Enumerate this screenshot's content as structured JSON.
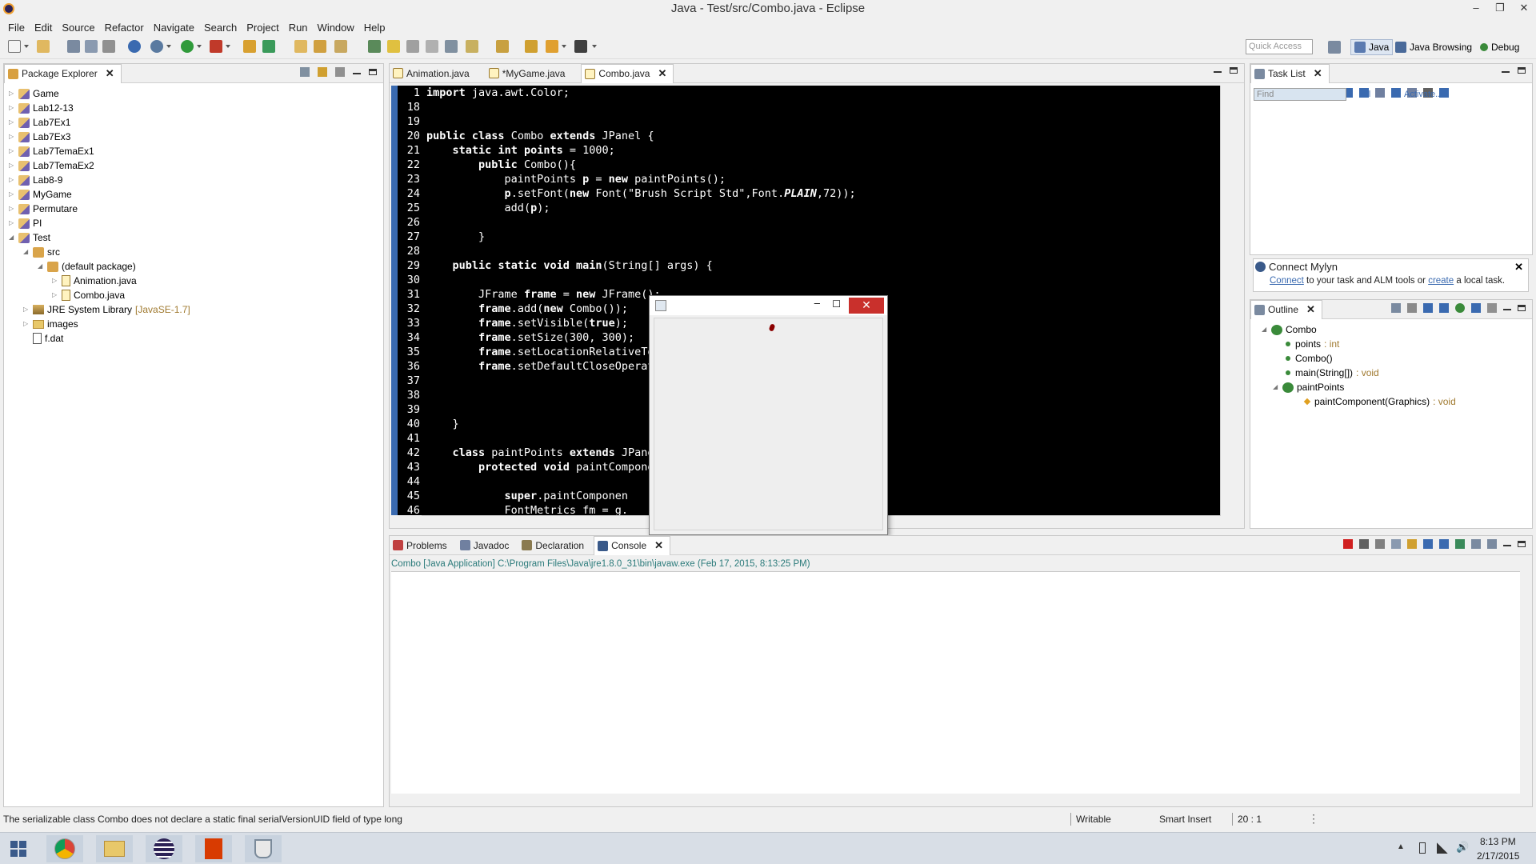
{
  "window": {
    "title": "Java - Test/src/Combo.java - Eclipse"
  },
  "menu": [
    "File",
    "Edit",
    "Source",
    "Refactor",
    "Navigate",
    "Search",
    "Project",
    "Run",
    "Window",
    "Help"
  ],
  "toolbar": {
    "quick_access_placeholder": "Quick Access"
  },
  "perspectives": [
    {
      "label": "Java",
      "active": true
    },
    {
      "label": "Java Browsing",
      "active": false
    },
    {
      "label": "Debug",
      "active": false
    }
  ],
  "package_explorer": {
    "title": "Package Explorer",
    "items": [
      {
        "label": "Game",
        "kind": "project",
        "depth": 0
      },
      {
        "label": "Lab12-13",
        "kind": "project",
        "depth": 0
      },
      {
        "label": "Lab7Ex1",
        "kind": "project",
        "depth": 0
      },
      {
        "label": "Lab7Ex3",
        "kind": "project",
        "depth": 0
      },
      {
        "label": "Lab7TemaEx1",
        "kind": "project",
        "depth": 0
      },
      {
        "label": "Lab7TemaEx2",
        "kind": "project",
        "depth": 0
      },
      {
        "label": "Lab8-9",
        "kind": "project",
        "depth": 0
      },
      {
        "label": "MyGame",
        "kind": "project",
        "depth": 0
      },
      {
        "label": "Permutare",
        "kind": "project",
        "depth": 0
      },
      {
        "label": "PI",
        "kind": "project",
        "depth": 0
      },
      {
        "label": "Test",
        "kind": "project",
        "depth": 0
      },
      {
        "label": "src",
        "kind": "source-folder",
        "depth": 1
      },
      {
        "label": "(default package)",
        "kind": "package",
        "depth": 2
      },
      {
        "label": "Animation.java",
        "kind": "java",
        "depth": 3
      },
      {
        "label": "Combo.java",
        "kind": "java",
        "depth": 3
      },
      {
        "label": "JRE System Library",
        "suffix": "[JavaSE-1.7]",
        "kind": "library",
        "depth": 1
      },
      {
        "label": "images",
        "kind": "folder",
        "depth": 1
      },
      {
        "label": "f.dat",
        "kind": "file",
        "depth": 1
      }
    ]
  },
  "editor": {
    "tabs": [
      {
        "label": "Animation.java",
        "active": false
      },
      {
        "label": "*MyGame.java",
        "active": false
      },
      {
        "label": "Combo.java",
        "active": true
      }
    ],
    "lines": [
      {
        "n": "1",
        "code": "import java.awt.Color;"
      },
      {
        "n": "18",
        "code": ""
      },
      {
        "n": "19",
        "code": ""
      },
      {
        "n": "20",
        "code": "public class Combo extends JPanel {"
      },
      {
        "n": "21",
        "code": "    static int points = 1000;"
      },
      {
        "n": "22",
        "code": "        public Combo(){"
      },
      {
        "n": "23",
        "code": "            paintPoints p = new paintPoints();"
      },
      {
        "n": "24",
        "code": "            p.setFont(new Font(\"Brush Script Std\",Font.PLAIN,72));"
      },
      {
        "n": "25",
        "code": "            add(p);"
      },
      {
        "n": "26",
        "code": ""
      },
      {
        "n": "27",
        "code": "        }"
      },
      {
        "n": "28",
        "code": ""
      },
      {
        "n": "29",
        "code": "    public static void main(String[] args) {"
      },
      {
        "n": "30",
        "code": ""
      },
      {
        "n": "31",
        "code": "        JFrame frame = new JFrame();"
      },
      {
        "n": "32",
        "code": "        frame.add(new Combo());"
      },
      {
        "n": "33",
        "code": "        frame.setVisible(true);"
      },
      {
        "n": "34",
        "code": "        frame.setSize(300, 300);"
      },
      {
        "n": "35",
        "code": "        frame.setLocationRelativeTo"
      },
      {
        "n": "36",
        "code": "        frame.setDefaultCloseOperat"
      },
      {
        "n": "37",
        "code": ""
      },
      {
        "n": "38",
        "code": ""
      },
      {
        "n": "39",
        "code": ""
      },
      {
        "n": "40",
        "code": "    }"
      },
      {
        "n": "41",
        "code": ""
      },
      {
        "n": "42",
        "code": "    class paintPoints extends JPanel"
      },
      {
        "n": "43",
        "code": "        protected void paintCompone"
      },
      {
        "n": "44",
        "code": ""
      },
      {
        "n": "45",
        "code": "            super.paintComponen"
      },
      {
        "n": "46",
        "code": "            FontMetrics fm = g."
      }
    ]
  },
  "bottom_panel": {
    "tabs": [
      {
        "label": "Problems",
        "active": false
      },
      {
        "label": "Javadoc",
        "active": false
      },
      {
        "label": "Declaration",
        "active": false
      },
      {
        "label": "Console",
        "active": true
      }
    ],
    "console_header": "Combo [Java Application] C:\\Program Files\\Java\\jre1.8.0_31\\bin\\javaw.exe (Feb 17, 2015, 8:13:25 PM)"
  },
  "task_list": {
    "title": "Task List",
    "find_placeholder": "Find",
    "all_label": "All",
    "activate_label": "Activate..."
  },
  "mylyn": {
    "title": "Connect Mylyn",
    "connect_link": "Connect",
    "text_mid": " to your task and ALM tools or ",
    "create_link": "create",
    "text_end": " a local task."
  },
  "outline": {
    "title": "Outline",
    "items": [
      {
        "label": "Combo",
        "detail": "",
        "depth": 0
      },
      {
        "label": "points",
        "detail": " : int",
        "depth": 1
      },
      {
        "label": "Combo()",
        "detail": "",
        "depth": 1
      },
      {
        "label": "main(String[])",
        "detail": " : void",
        "depth": 1
      },
      {
        "label": "paintPoints",
        "detail": "",
        "depth": 1
      },
      {
        "label": "paintComponent(Graphics)",
        "detail": " : void",
        "depth": 2
      }
    ]
  },
  "status": {
    "message": "The serializable class Combo does not declare a static final serialVersionUID field of type long",
    "mode": "Writable",
    "insert": "Smart Insert",
    "position": "20 : 1"
  },
  "taskbar": {
    "time": "8:13 PM",
    "date": "2/17/2015"
  }
}
